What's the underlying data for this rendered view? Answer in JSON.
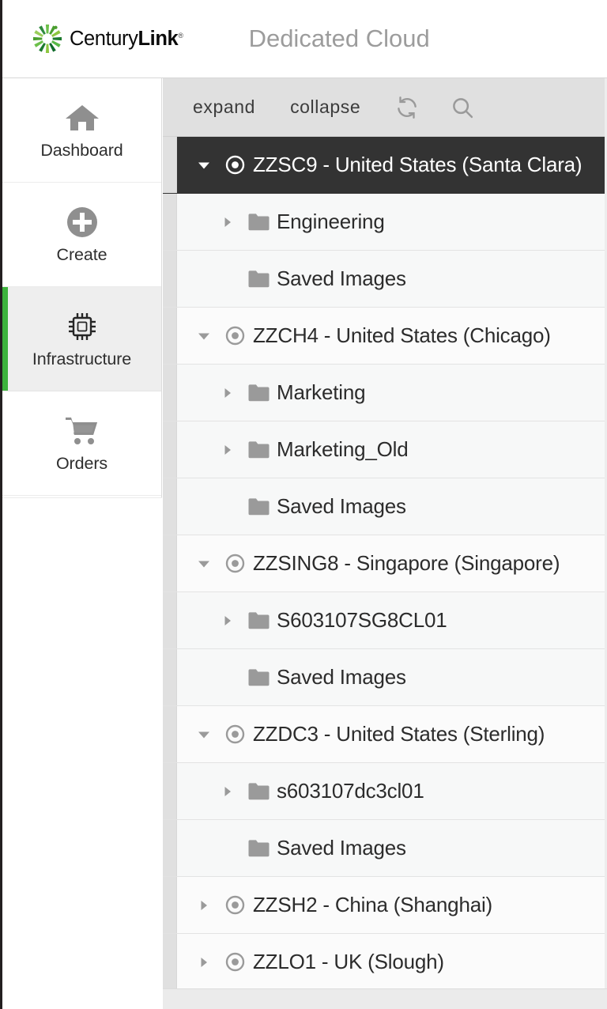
{
  "header": {
    "logo_name": "centurylink-logo",
    "brand_part1": "Century",
    "brand_part2": "Link",
    "brand_reg": "®",
    "app_title": "Dedicated Cloud"
  },
  "colors": {
    "brand_green": "#3db33d",
    "active_bar": "#3db33d",
    "selected_row_bg": "#333333",
    "toolbar_bg": "#e0e0e0",
    "title_gray": "#9c9c9c",
    "icon_gray": "#9a9a9a"
  },
  "sidebar": {
    "items": [
      {
        "label": "Dashboard",
        "icon": "home-icon",
        "active": false
      },
      {
        "label": "Create",
        "icon": "plus-circle-icon",
        "active": false
      },
      {
        "label": "Infrastructure",
        "icon": "cpu-chip-icon",
        "active": true
      },
      {
        "label": "Orders",
        "icon": "shopping-cart-icon",
        "active": false
      }
    ]
  },
  "tree_toolbar": {
    "expand_label": "expand",
    "collapse_label": "collapse",
    "refresh_icon": "refresh-icon",
    "search_icon": "search-icon"
  },
  "tree": {
    "rows": [
      {
        "label": "ZZSC9 - United States (Santa Clara)",
        "level": 0,
        "icon": "target-icon",
        "twisty": "down",
        "selected": true
      },
      {
        "label": "Engineering",
        "level": 1,
        "icon": "folder-icon",
        "twisty": "right",
        "selected": false
      },
      {
        "label": "Saved Images",
        "level": 1,
        "icon": "folder-icon",
        "twisty": "none",
        "selected": false
      },
      {
        "label": "ZZCH4 - United States (Chicago)",
        "level": 0,
        "icon": "target-icon",
        "twisty": "down",
        "selected": false
      },
      {
        "label": "Marketing",
        "level": 1,
        "icon": "folder-icon",
        "twisty": "right",
        "selected": false
      },
      {
        "label": "Marketing_Old",
        "level": 1,
        "icon": "folder-icon",
        "twisty": "right",
        "selected": false
      },
      {
        "label": "Saved Images",
        "level": 1,
        "icon": "folder-icon",
        "twisty": "none",
        "selected": false
      },
      {
        "label": "ZZSING8 - Singapore (Singapore)",
        "level": 0,
        "icon": "target-icon",
        "twisty": "down",
        "selected": false
      },
      {
        "label": "S603107SG8CL01",
        "level": 1,
        "icon": "folder-icon",
        "twisty": "right",
        "selected": false
      },
      {
        "label": "Saved Images",
        "level": 1,
        "icon": "folder-icon",
        "twisty": "none",
        "selected": false
      },
      {
        "label": "ZZDC3 - United States (Sterling)",
        "level": 0,
        "icon": "target-icon",
        "twisty": "down",
        "selected": false
      },
      {
        "label": "s603107dc3cl01",
        "level": 1,
        "icon": "folder-icon",
        "twisty": "right",
        "selected": false
      },
      {
        "label": "Saved Images",
        "level": 1,
        "icon": "folder-icon",
        "twisty": "none",
        "selected": false
      },
      {
        "label": "ZZSH2 - China (Shanghai)",
        "level": 0,
        "icon": "target-icon",
        "twisty": "right",
        "selected": false
      },
      {
        "label": "ZZLO1 - UK (Slough)",
        "level": 0,
        "icon": "target-icon",
        "twisty": "right",
        "selected": false
      }
    ]
  }
}
